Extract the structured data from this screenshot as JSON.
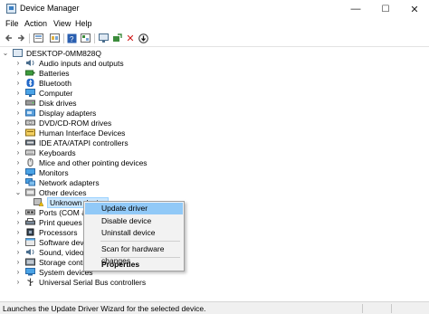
{
  "window": {
    "title": "Device Manager",
    "minimize": "—",
    "maximize": "☐",
    "close": "✕"
  },
  "menu": [
    "File",
    "Action",
    "View",
    "Help"
  ],
  "toolbar": {
    "icons": [
      "back-icon",
      "forward-icon",
      "properties-view-icon",
      "show-hidden-icon",
      "help-icon",
      "resources-view-icon",
      "scan-hardware-icon",
      "remove-device-icon",
      "update-driver-icon"
    ]
  },
  "tree": {
    "root": "DESKTOP-0MM828Q",
    "items": [
      {
        "label": "Audio inputs and outputs",
        "expanded": false,
        "icon": "audio-icon"
      },
      {
        "label": "Batteries",
        "expanded": false,
        "icon": "battery-icon"
      },
      {
        "label": "Bluetooth",
        "expanded": false,
        "icon": "bluetooth-icon"
      },
      {
        "label": "Computer",
        "expanded": false,
        "icon": "computer-icon"
      },
      {
        "label": "Disk drives",
        "expanded": false,
        "icon": "disk-icon"
      },
      {
        "label": "Display adapters",
        "expanded": false,
        "icon": "display-adapter-icon"
      },
      {
        "label": "DVD/CD-ROM drives",
        "expanded": false,
        "icon": "dvd-icon"
      },
      {
        "label": "Human Interface Devices",
        "expanded": false,
        "icon": "hid-icon"
      },
      {
        "label": "IDE ATA/ATAPI controllers",
        "expanded": false,
        "icon": "ide-icon"
      },
      {
        "label": "Keyboards",
        "expanded": false,
        "icon": "keyboard-icon"
      },
      {
        "label": "Mice and other pointing devices",
        "expanded": false,
        "icon": "mouse-icon"
      },
      {
        "label": "Monitors",
        "expanded": false,
        "icon": "monitor-icon"
      },
      {
        "label": "Network adapters",
        "expanded": false,
        "icon": "network-icon"
      },
      {
        "label": "Other devices",
        "expanded": true,
        "icon": "other-devices-icon"
      },
      {
        "label": "Unknown device",
        "child": true,
        "selected": true,
        "icon": "unknown-device-icon"
      },
      {
        "label": "Ports (COM & L",
        "expanded": false,
        "icon": "ports-icon"
      },
      {
        "label": "Print queues",
        "expanded": false,
        "icon": "printer-icon"
      },
      {
        "label": "Processors",
        "expanded": false,
        "icon": "processor-icon"
      },
      {
        "label": "Software devices",
        "expanded": false,
        "icon": "software-device-icon"
      },
      {
        "label": "Sound, video an",
        "expanded": false,
        "icon": "sound-icon"
      },
      {
        "label": "Storage controll",
        "expanded": false,
        "icon": "storage-icon"
      },
      {
        "label": "System devices",
        "expanded": false,
        "icon": "system-device-icon"
      },
      {
        "label": "Universal Serial Bus controllers",
        "expanded": false,
        "icon": "usb-icon"
      }
    ]
  },
  "context_menu": {
    "items": [
      "Update driver",
      "Disable device",
      "Uninstall device",
      "Scan for hardware changes",
      "Properties"
    ],
    "highlighted": "Update driver",
    "bold": "Properties"
  },
  "status": {
    "text": "Launches the Update Driver Wizard for the selected device."
  },
  "colors": {
    "selection": "#cce8ff",
    "menu_highlight": "#91c9f7",
    "status_bar": "#f0f0f0"
  }
}
